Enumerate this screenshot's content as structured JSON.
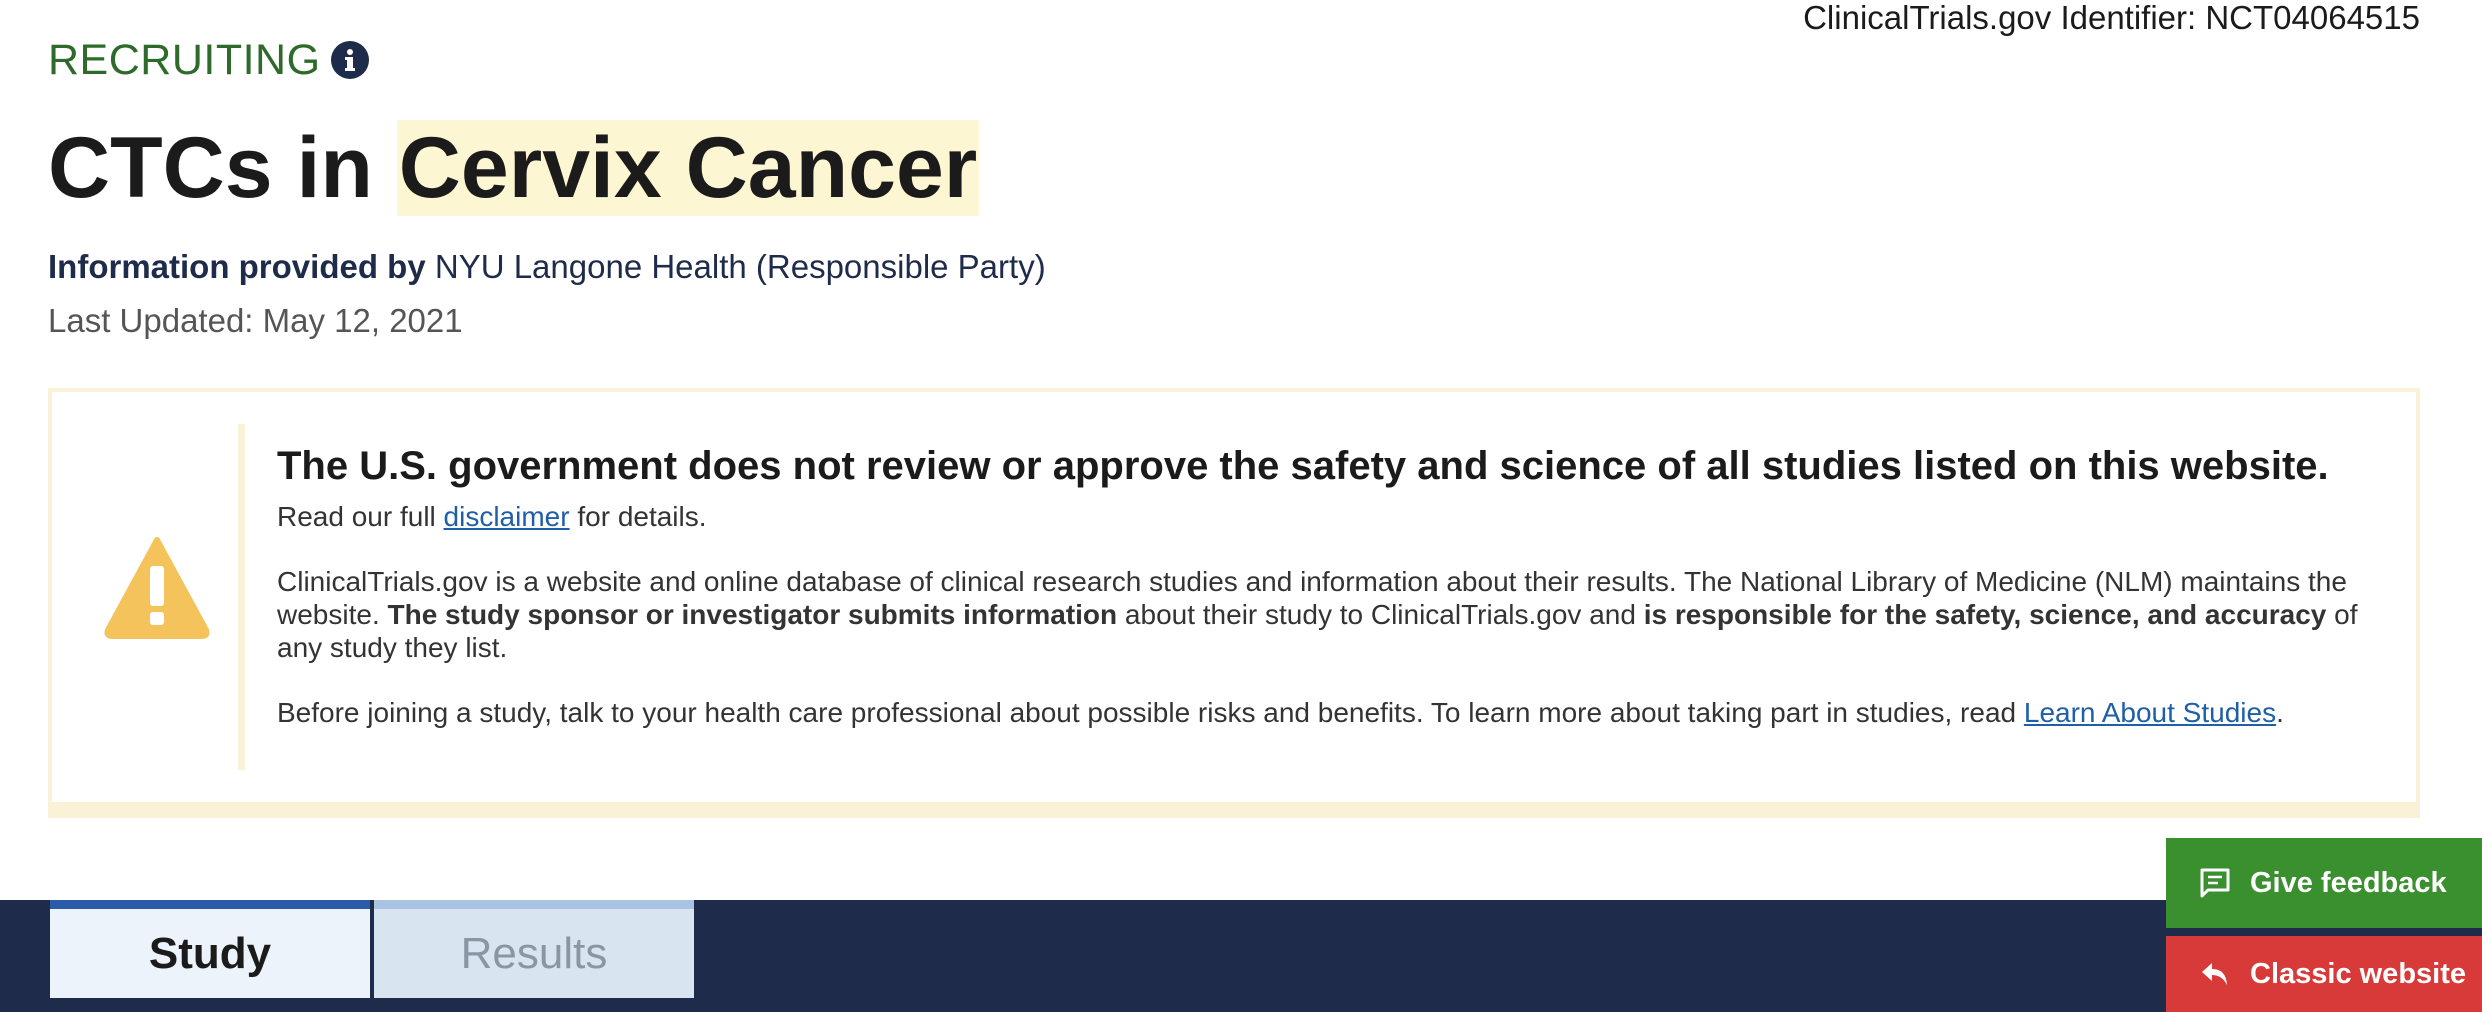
{
  "header": {
    "identifier": "ClinicalTrials.gov Identifier: NCT04064515",
    "status": "RECRUITING",
    "title_prefix": "CTCs in ",
    "title_highlight": "Cervix Cancer",
    "provided_label": "Information provided by",
    "provided_value": " NYU Langone Health (Responsible Party)",
    "last_updated": "Last Updated: May 12, 2021"
  },
  "disclaimer": {
    "heading": "The U.S. government does not review or approve the safety and science of all studies listed on this website.",
    "read_prefix": "Read our full ",
    "read_link": "disclaimer",
    "read_suffix": " for details.",
    "p2_a": "ClinicalTrials.gov is a website and online database of clinical research studies and information about their results. The National Library of Medicine (NLM) maintains the website. ",
    "p2_b": "The study sponsor or investigator submits information",
    "p2_c": " about their study to ClinicalTrials.gov and ",
    "p2_d": "is responsible for the safety, science, and accuracy",
    "p2_e": " of any study they list.",
    "p3_a": "Before joining a study, talk to your health care professional about possible risks and benefits. To learn more about taking part in studies, read ",
    "p3_link": "Learn About Studies",
    "p3_end": "."
  },
  "tabs": [
    {
      "label": "Study",
      "active": true
    },
    {
      "label": "Results",
      "active": false
    }
  ],
  "actions": {
    "feedback": "Give feedback",
    "classic": "Classic website"
  },
  "colors": {
    "status_green": "#2e6b2a",
    "navy": "#1e2b4a",
    "highlight": "#fdf6d3",
    "warning_yellow": "#f5c35b",
    "feedback_green": "#3a8f2e",
    "classic_red": "#d83a3a",
    "link_blue": "#1f5ea8"
  },
  "icons": [
    "info-icon",
    "warning-triangle-icon",
    "feedback-icon",
    "back-arrow-icon"
  ]
}
